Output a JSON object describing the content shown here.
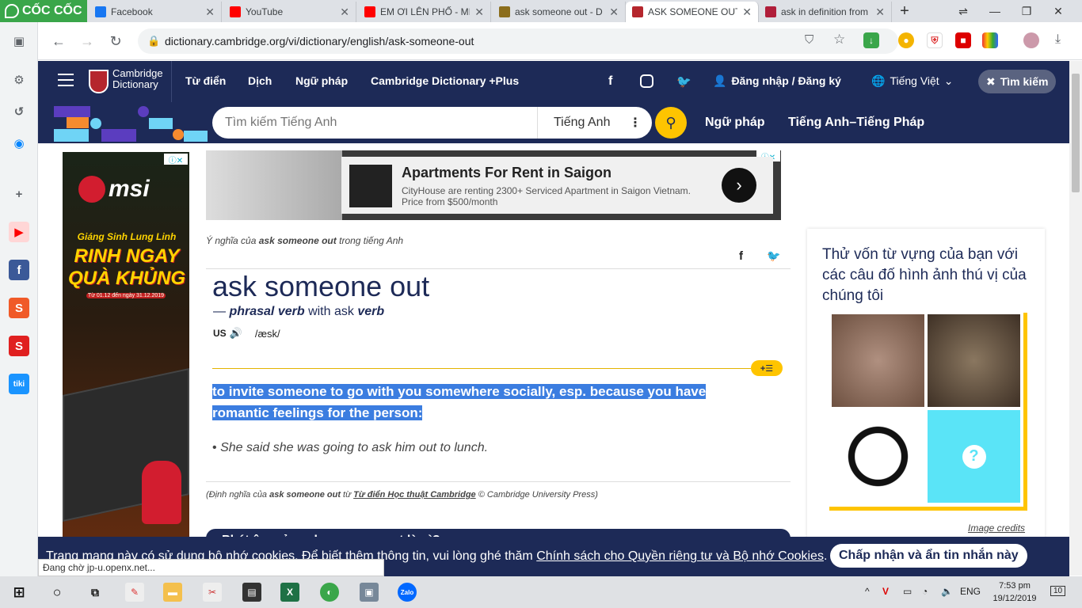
{
  "browser": {
    "brand": "CỐC CỐC",
    "tabs": [
      {
        "title": "Facebook",
        "icon": "facebook-icon",
        "color": "#1877f2"
      },
      {
        "title": "YouTube",
        "icon": "youtube-icon",
        "color": "#ff0000"
      },
      {
        "title": "EM ƠI LÊN PHỐ - MI",
        "icon": "youtube-icon",
        "color": "#ff0000"
      },
      {
        "title": "ask someone out - D",
        "icon": "dictionary-icon",
        "color": "#8b6d1c"
      },
      {
        "title": "ASK SOMEONE OUT",
        "icon": "cambridge-icon",
        "color": "#b5262d"
      },
      {
        "title": "ask in definition from",
        "icon": "book-icon",
        "color": "#b01e3a"
      }
    ],
    "new_tab": "+",
    "url": "dictionary.cambridge.org/vi/dictionary/english/ask-someone-out",
    "status_text": "Đang chờ jp-u.openx.net..."
  },
  "cambridge": {
    "logo_line1": "Cambridge",
    "logo_line2": "Dictionary",
    "nav": [
      "Từ điển",
      "Dịch",
      "Ngữ pháp",
      "Cambridge Dictionary +Plus"
    ],
    "login": "Đăng nhập / Đăng ký",
    "language": "Tiếng Việt",
    "search_toggle": "Tìm kiếm",
    "search_placeholder": "Tìm kiếm Tiếng Anh",
    "search_lang": "Tiếng Anh",
    "sub_links": [
      "Ngữ pháp",
      "Tiếng Anh–Tiếng Pháp"
    ]
  },
  "ad_top": {
    "title": "Apartments For Rent in Saigon",
    "body1": "CityHouse are renting 2300+ Serviced Apartment in Saigon Vietnam.",
    "body2": "Price from $500/month"
  },
  "ad_side": {
    "brand": "msi",
    "line1": "Giáng Sinh Lung Linh",
    "line2": "RINH NGAY",
    "line3": "QUÀ KHỦNG",
    "dates": "Từ 01.12 đến ngày 31.12.2019"
  },
  "entry": {
    "meaning_prefix": "Ý nghĩa của",
    "meaning_word": "ask someone out",
    "meaning_suffix": "trong tiếng Anh",
    "headword": "ask someone out",
    "dash": "—",
    "pos": "phrasal verb",
    "with_text": "with ask",
    "pos2": "verb",
    "region": "US",
    "ipa": "/æsk/",
    "definition": "to invite someone to go with you somewhere socially, esp. because you have romantic feelings for the person:",
    "example": "She said she was going to ask him out to lunch.",
    "source_prefix": "(Định nghĩa của",
    "source_word": "ask someone out",
    "source_from": "từ",
    "source_book": "Từ điển Học thuật Cambridge",
    "source_suffix": "© Cambridge University Press)",
    "next_section": "Phát âm của ask someone out là gì?"
  },
  "quiz": {
    "text": "Thử vốn từ vựng của bạn với các câu đố hình ảnh thú vị của chúng tôi",
    "credits": "Image credits",
    "question_mark": "?"
  },
  "cookie": {
    "text": "Trang mạng này có sử dụng bộ nhớ cookies. Để biết thêm thông tin, vui lòng ghé thăm",
    "link": "Chính sách cho Quyền riêng tư và Bộ nhớ Cookies",
    "period": ".",
    "button": "Chấp nhận và ẩn tin nhắn này"
  },
  "taskbar": {
    "lang": "ENG",
    "time": "7:53 pm",
    "date": "19/12/2019",
    "notif": "10"
  },
  "colors": {
    "cambridge_navy": "#1d2a57",
    "search_yellow": "#fec400",
    "highlight": "#3b7de0",
    "coccoc_green": "#3aa64a"
  }
}
